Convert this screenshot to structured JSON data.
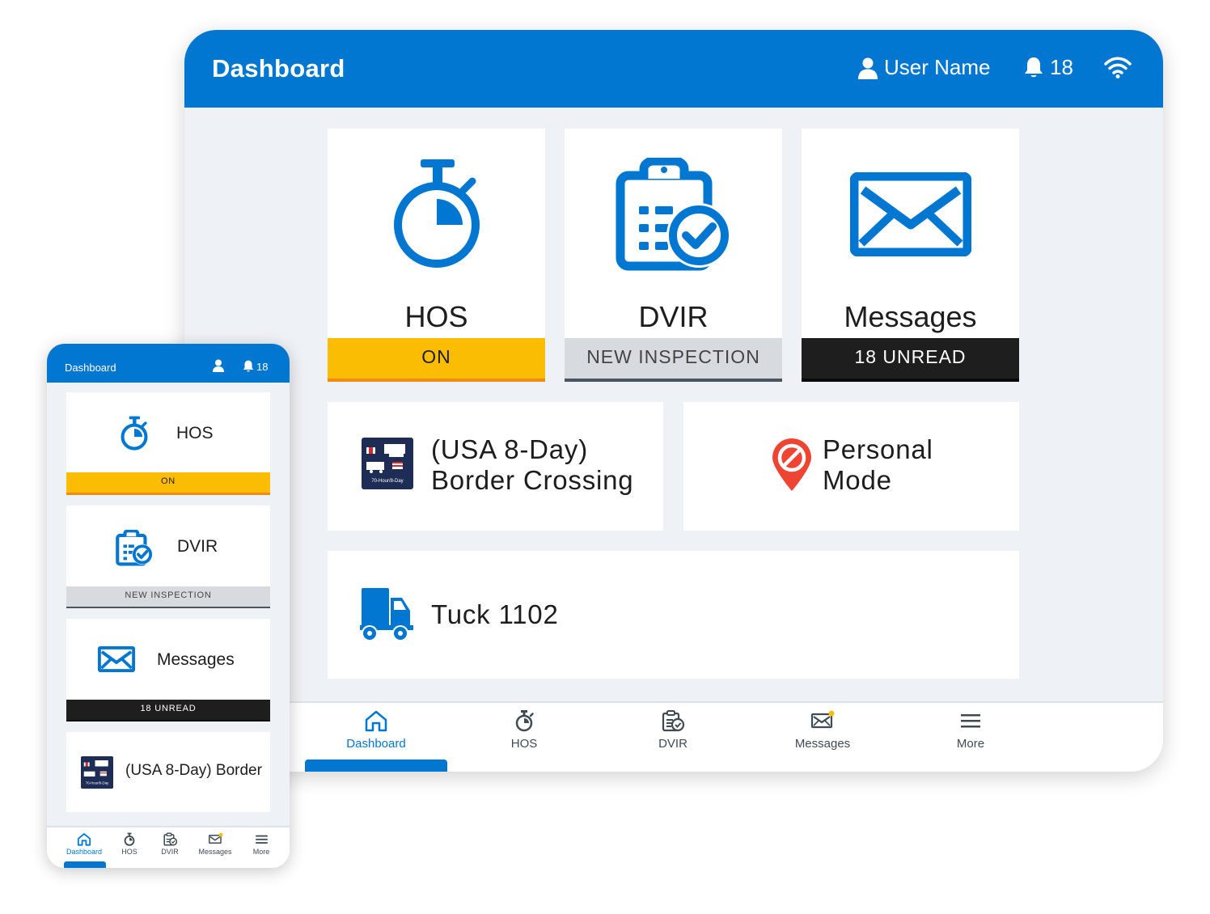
{
  "colors": {
    "primary": "#0277d2",
    "on_status": "#fbbc04",
    "unread_status": "#1e1e1e",
    "inspection_status": "#d7dbe0",
    "personal_pin": "#f04433"
  },
  "tablet": {
    "header": {
      "title": "Dashboard",
      "user_name": "User Name",
      "notification_count": "18",
      "wifi_icon": "wifi-icon"
    },
    "tiles": [
      {
        "label": "HOS",
        "status": "ON",
        "icon": "stopwatch-icon"
      },
      {
        "label": "DVIR",
        "status": "NEW INSPECTION",
        "icon": "clipboard-check-icon"
      },
      {
        "label": "Messages",
        "status": "18 UNREAD",
        "icon": "envelope-icon"
      }
    ],
    "border_crossing": {
      "line1": "(USA 8-Day)",
      "line2": "Border Crossing",
      "badge_text": "70-Hour/8-Day"
    },
    "personal_mode": {
      "line1": "Personal",
      "line2": "Mode"
    },
    "truck": {
      "label": "Tuck 1102"
    },
    "nav": [
      {
        "label": "Dashboard"
      },
      {
        "label": "HOS"
      },
      {
        "label": "DVIR"
      },
      {
        "label": "Messages"
      },
      {
        "label": "More"
      }
    ]
  },
  "phone": {
    "header": {
      "title": "Dashboard",
      "notification_count": "18"
    },
    "cards": [
      {
        "label": "HOS",
        "status": "ON"
      },
      {
        "label": "DVIR",
        "status": "NEW INSPECTION"
      },
      {
        "label": "Messages",
        "status": "18 UNREAD"
      },
      {
        "label": "(USA 8-Day) Border"
      }
    ],
    "nav": [
      {
        "label": "Dashboard"
      },
      {
        "label": "HOS"
      },
      {
        "label": "DVIR"
      },
      {
        "label": "Messages"
      },
      {
        "label": "More"
      }
    ]
  }
}
